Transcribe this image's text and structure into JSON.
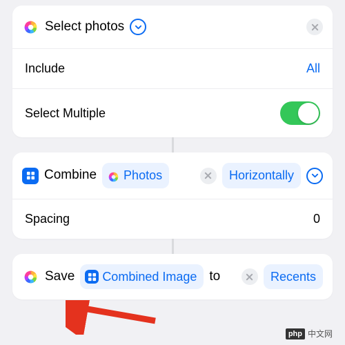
{
  "card1": {
    "title": "Select photos",
    "include_label": "Include",
    "include_value": "All",
    "multiple_label": "Select Multiple",
    "multiple_value": true
  },
  "card2": {
    "verb": "Combine",
    "input_pill": "Photos",
    "direction": "Horizontally",
    "spacing_label": "Spacing",
    "spacing_value": "0"
  },
  "card3": {
    "verb": "Save",
    "input_pill": "Combined Image",
    "to_label": "to",
    "destination": "Recents"
  },
  "watermark": {
    "logo": "php",
    "text": "中文网"
  }
}
